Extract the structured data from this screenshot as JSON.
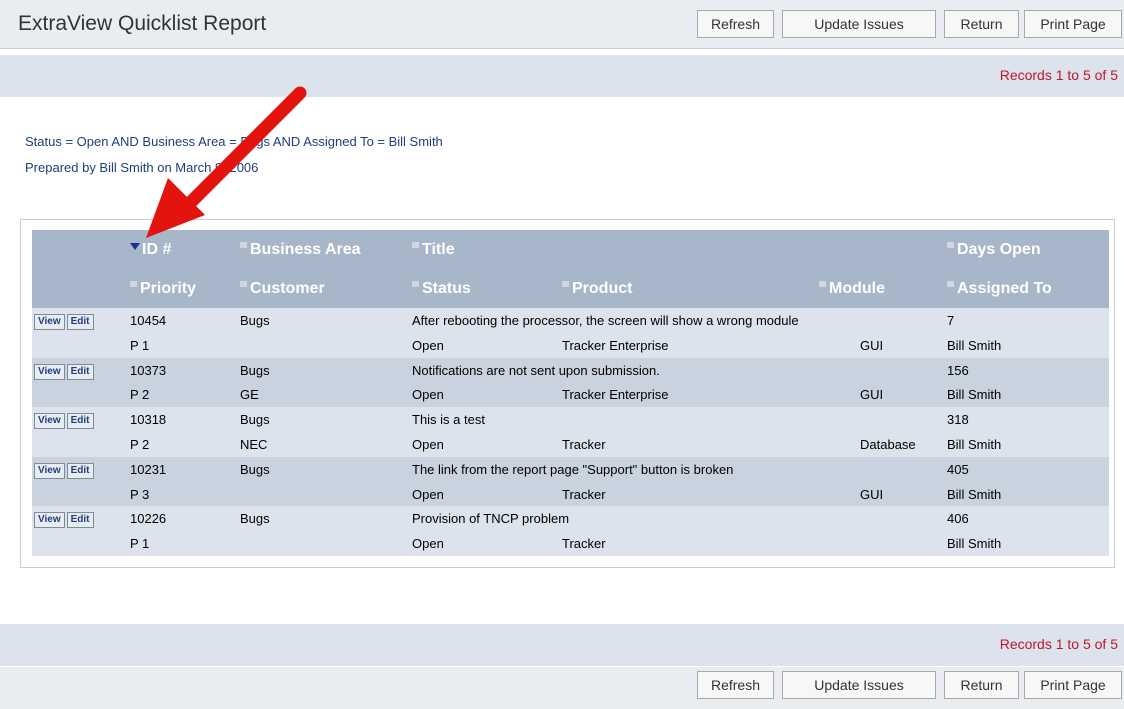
{
  "app": {
    "title": "ExtraView Quicklist Report"
  },
  "toolbar": {
    "refresh": "Refresh",
    "update_issues": "Update Issues",
    "return": "Return",
    "print_page": "Print Page"
  },
  "records_text": "Records 1 to 5 of 5",
  "criteria": {
    "filter": "Status = Open AND Business Area = Bugs AND Assigned To = Bill Smith",
    "prepared": "Prepared by Bill Smith on March 9, 2006"
  },
  "columns": {
    "row1": {
      "id": "ID #",
      "business_area": "Business Area",
      "title": "Title",
      "days_open": "Days Open"
    },
    "row2": {
      "priority": "Priority",
      "customer": "Customer",
      "status": "Status",
      "product": "Product",
      "module": "Module",
      "assigned_to": "Assigned To"
    }
  },
  "row_buttons": {
    "view": "View",
    "edit": "Edit"
  },
  "rows": [
    {
      "id": "10454",
      "business_area": "Bugs",
      "title": "After rebooting the processor, the screen will show a wrong module",
      "days_open": "7",
      "priority": "P 1",
      "customer": "",
      "status": "Open",
      "product": "Tracker Enterprise",
      "module": "GUI",
      "assigned_to": "Bill Smith"
    },
    {
      "id": "10373",
      "business_area": "Bugs",
      "title": "Notifications are not sent upon submission.",
      "days_open": "156",
      "priority": "P 2",
      "customer": "GE",
      "status": "Open",
      "product": "Tracker Enterprise",
      "module": "GUI",
      "assigned_to": "Bill Smith"
    },
    {
      "id": "10318",
      "business_area": "Bugs",
      "title": "This is a test",
      "days_open": "318",
      "priority": "P 2",
      "customer": "NEC",
      "status": "Open",
      "product": "Tracker",
      "module": "Database",
      "assigned_to": "Bill Smith"
    },
    {
      "id": "10231",
      "business_area": "Bugs",
      "title": "The link from the report page \"Support\" button is broken",
      "days_open": "405",
      "priority": "P 3",
      "customer": "",
      "status": "Open",
      "product": "Tracker",
      "module": "GUI",
      "assigned_to": "Bill Smith"
    },
    {
      "id": "10226",
      "business_area": "Bugs",
      "title": "Provision of TNCP problem",
      "days_open": "406",
      "priority": "P 1",
      "customer": "",
      "status": "Open",
      "product": "Tracker",
      "module": "",
      "assigned_to": "Bill Smith"
    }
  ],
  "colors": {
    "header_bg": "#a8b6c9",
    "row_light": "#dde3ec",
    "row_dark": "#c9d2df",
    "records_red": "#c0162a",
    "arrow_red": "#e3130e",
    "sort_indicator": "#1a2f8f"
  },
  "icons": {
    "sort": "sort-descending-icon",
    "column_marker": "column-square-icon",
    "annotation": "red-arrow-icon"
  }
}
